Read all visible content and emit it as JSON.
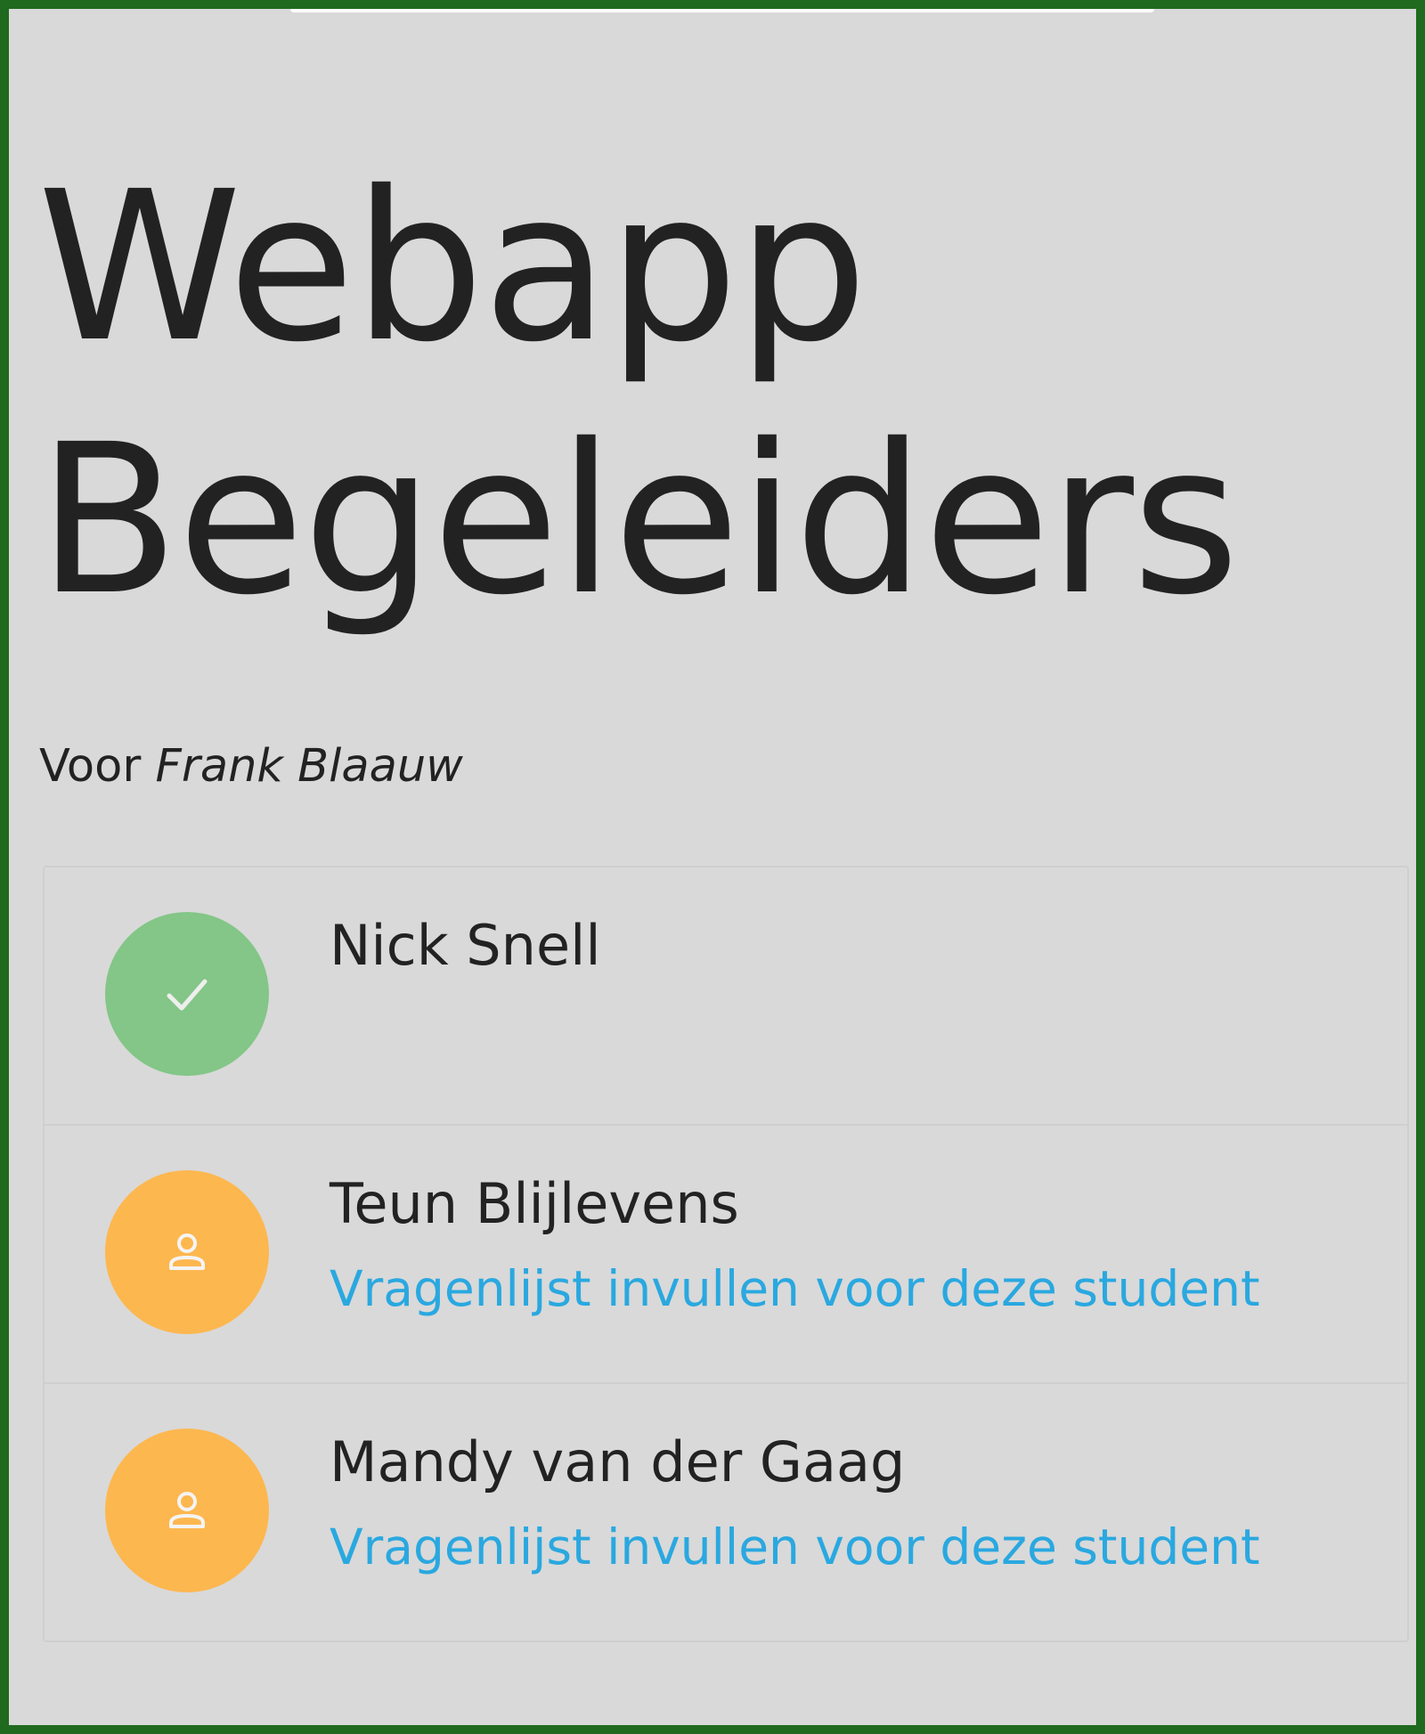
{
  "header": {
    "title_line1": "Webapp",
    "title_line2": "Begeleiders"
  },
  "subtitle": {
    "prefix": "Voor",
    "name": "Frank Blaauw"
  },
  "colors": {
    "done": "#83c687",
    "pending": "#fdb74f",
    "link": "#2aa8e0",
    "background": "#d9d9d9",
    "frame": "#1f6a1f"
  },
  "students": [
    {
      "name": "Nick Snell",
      "status": "done",
      "icon": "check-icon",
      "action": ""
    },
    {
      "name": "Teun Blijlevens",
      "status": "pending",
      "icon": "person-icon",
      "action": "Vragenlijst invullen voor deze student"
    },
    {
      "name": "Mandy van der Gaag",
      "status": "pending",
      "icon": "person-icon",
      "action": "Vragenlijst invullen voor deze student"
    }
  ]
}
